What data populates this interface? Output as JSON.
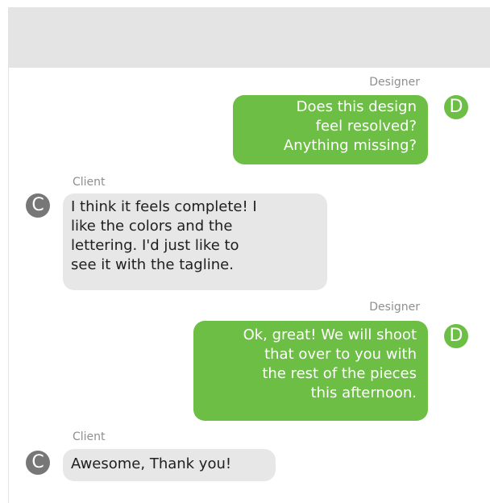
{
  "colors": {
    "header_bg": "#e4e4e4",
    "designer_bubble": "#6dbe45",
    "client_bubble": "#e7e7e7",
    "designer_avatar": "#6dbe45",
    "client_avatar": "#777777"
  },
  "messages": [
    {
      "sender": "Designer",
      "avatar": "D",
      "text": "Does this design\nfeel resolved?\nAnything missing?"
    },
    {
      "sender": "Client",
      "avatar": "C",
      "text": "I think it feels complete! I\nlike the colors and the\nlettering. I'd just like to\nsee it with the tagline."
    },
    {
      "sender": "Designer",
      "avatar": "D",
      "text": "Ok, great! We will shoot\nthat over to you with\nthe rest of the pieces\nthis afternoon."
    },
    {
      "sender": "Client",
      "avatar": "C",
      "text": "Awesome, Thank you!"
    }
  ]
}
